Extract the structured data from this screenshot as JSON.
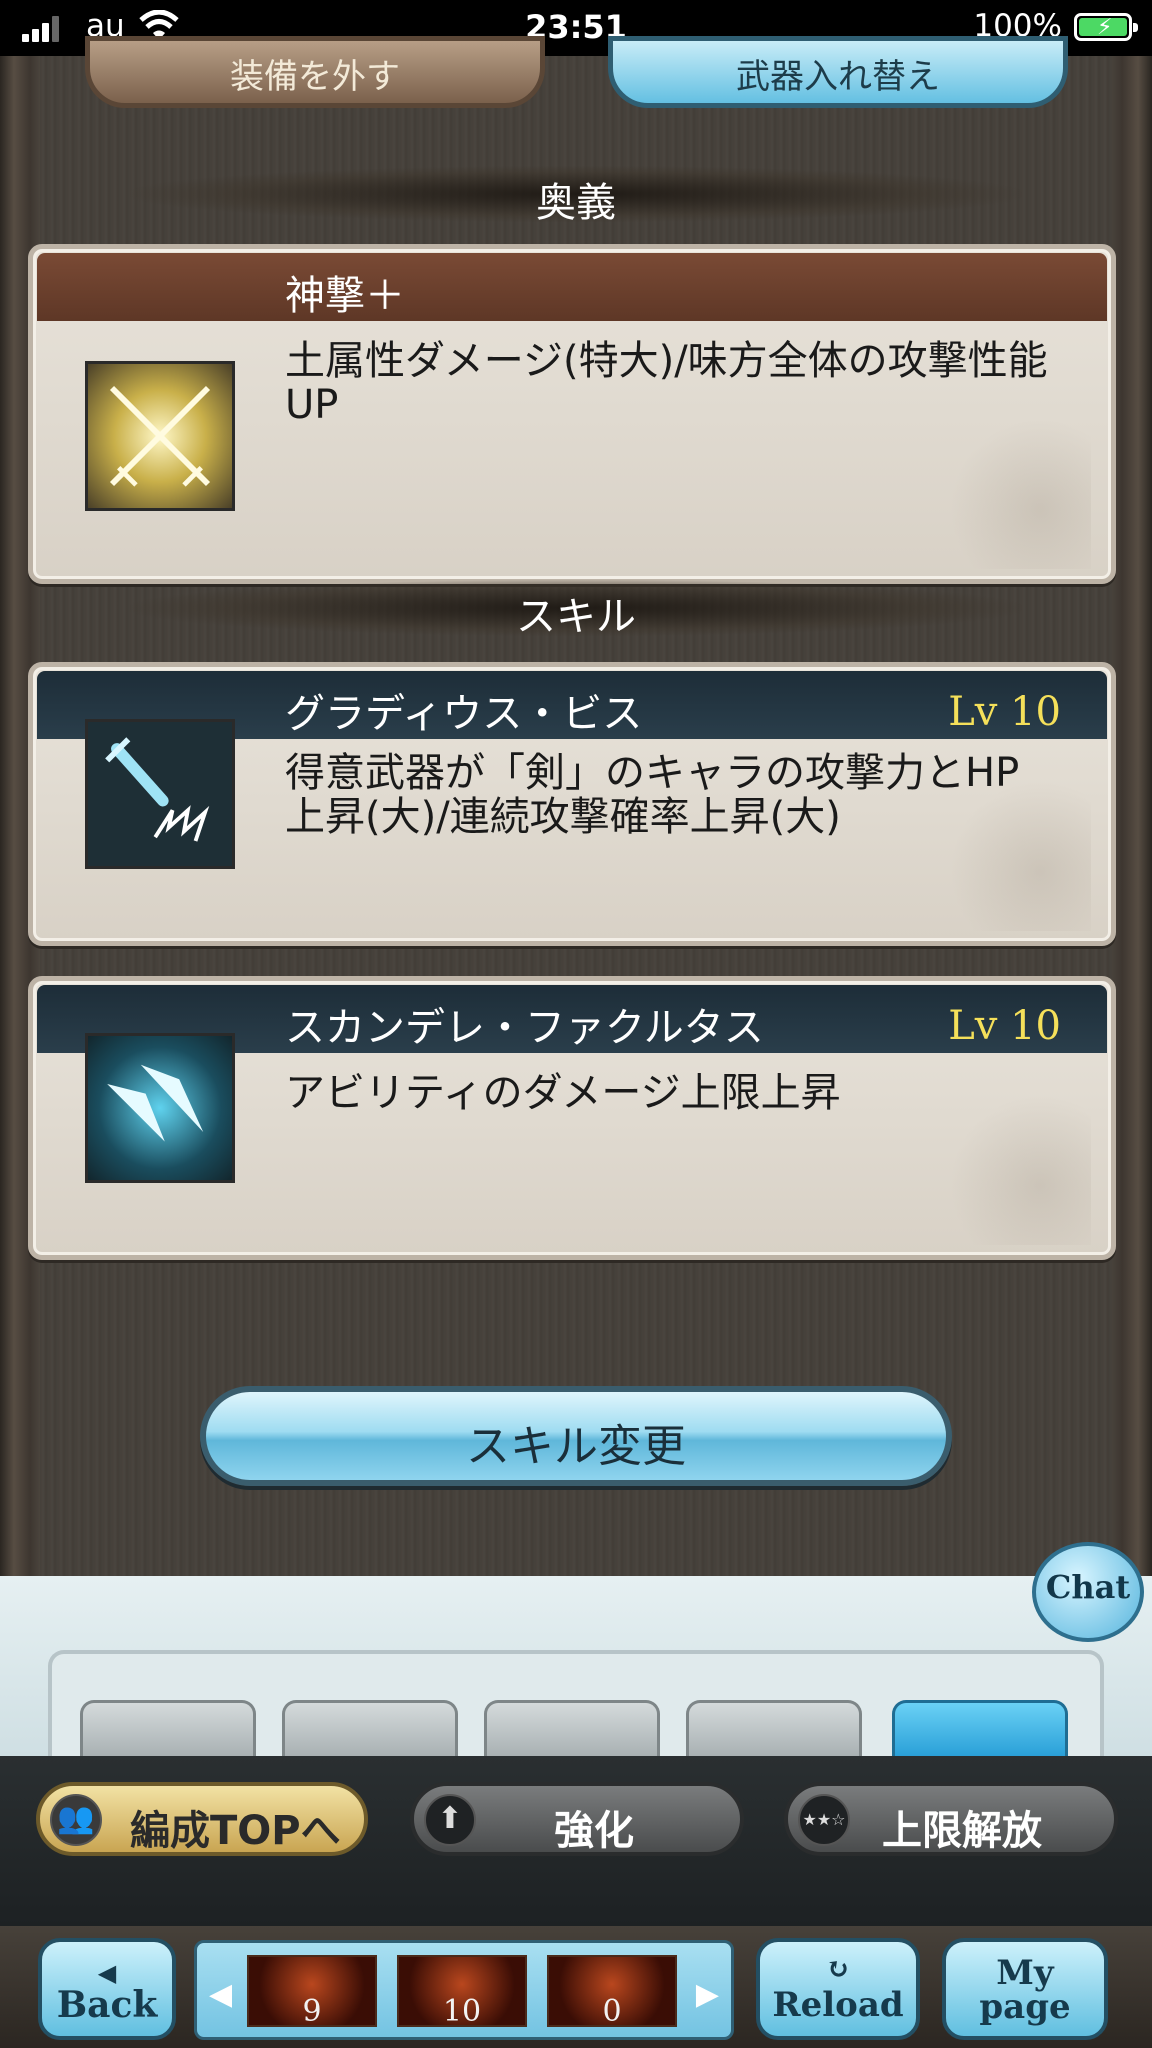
{
  "status_bar": {
    "carrier": "au",
    "time": "23:51",
    "battery_percent": "100%"
  },
  "top_buttons": {
    "left_label": "装備を外す",
    "right_label": "武器入れ替え"
  },
  "sections": {
    "ougi_label": "奥義",
    "skill_label": "スキル"
  },
  "ougi": {
    "name": "神撃＋",
    "description": "土属性ダメージ(特大)/味方全体の攻撃性能UP"
  },
  "skills": [
    {
      "name": "グラディウス・ビス",
      "level": "Lv 10",
      "description": "得意武器が「剣」のキャラの攻撃力とHP上昇(大)/連続攻撃確率上昇(大)"
    },
    {
      "name": "スカンデレ・ファクルタス",
      "level": "Lv 10",
      "description": "アビリティのダメージ上限上昇"
    }
  ],
  "skill_change_button": "スキル変更",
  "chat_label": "Chat",
  "action_bar": {
    "party_top": "編成TOPへ",
    "enhance": "強化",
    "uncap": "上限解放"
  },
  "nav": {
    "back": "Back",
    "reload": "Reload",
    "my_page_line1": "My",
    "my_page_line2": "page",
    "slots": [
      "9",
      "10",
      "0"
    ]
  },
  "colors": {
    "accent_blue": "#5fb7da",
    "level_text": "#f5e05a",
    "ougi_header": "#6b3f2d",
    "skill_header": "#22333f"
  }
}
